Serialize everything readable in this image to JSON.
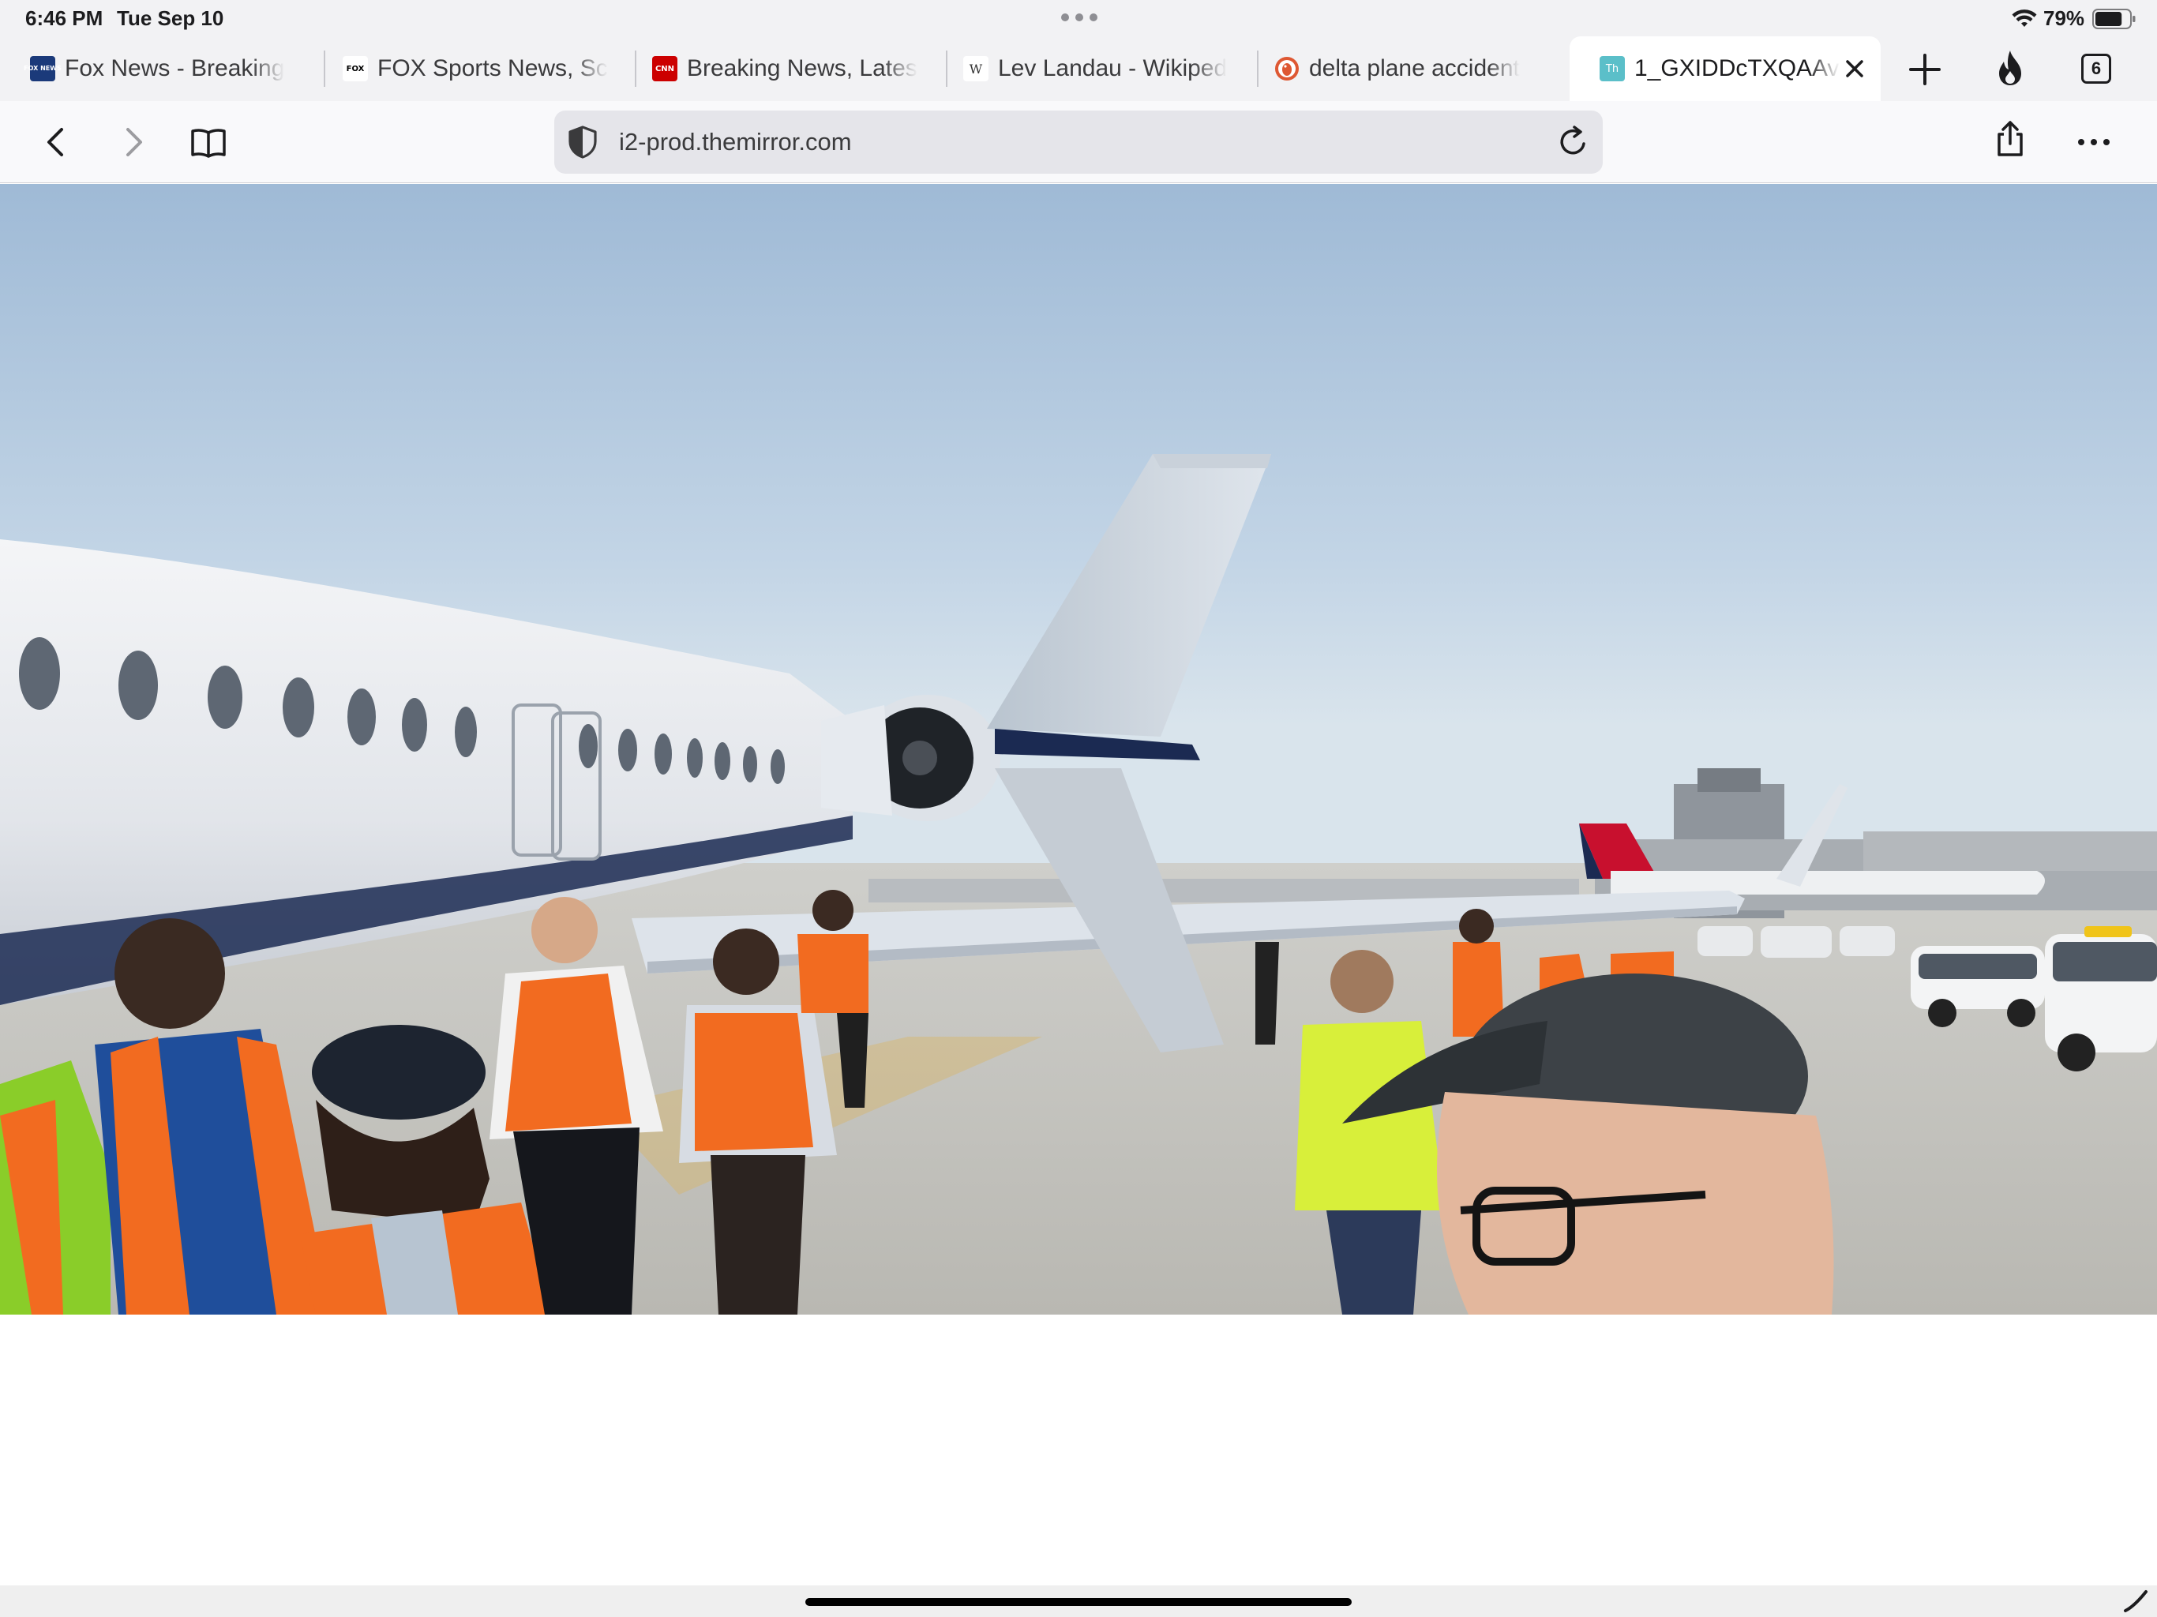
{
  "status_bar": {
    "time": "6:46 PM",
    "date": "Tue Sep 10",
    "battery_percent": "79%",
    "battery_level": 0.79,
    "icons": [
      "multitask-dots-icon",
      "wifi-icon",
      "battery-icon"
    ]
  },
  "tabs": [
    {
      "title": "Fox News - Breaking",
      "favicon": "fox-news-favicon",
      "active": false
    },
    {
      "title": "FOX Sports News, Sc",
      "favicon": "fox-sports-favicon",
      "active": false
    },
    {
      "title": "Breaking News, Lates",
      "favicon": "cnn-favicon",
      "active": false
    },
    {
      "title": "Lev Landau - Wikiped",
      "favicon": "wikipedia-favicon",
      "active": false
    },
    {
      "title": "delta plane accident",
      "favicon": "duckduckgo-favicon",
      "active": false
    },
    {
      "title": "1_GXIDDcTXQAAv",
      "favicon": "th-favicon",
      "active": true
    }
  ],
  "tab_favicons": {
    "fox_news": "FOX NEWS",
    "fox_sports": "FOX",
    "cnn": "CNN",
    "wikipedia": "W",
    "th": "Th"
  },
  "tab_bar_controls": {
    "icons": [
      "plus-icon",
      "flame-icon",
      "tab-overview-icon"
    ],
    "tab_count": "6"
  },
  "toolbar": {
    "icons": [
      "chevron-left-icon",
      "chevron-right-icon",
      "book-icon",
      "shield-icon",
      "reload-icon",
      "share-icon",
      "ellipsis-icon"
    ],
    "url": "i2-prod.themirror.com"
  },
  "content": {
    "image_subject": "photo",
    "icons": []
  },
  "colors": {
    "chrome_bg": "#f2f2f4",
    "url_field_bg": "#e5e5ea",
    "fox_news_blue": "#1b3a7a",
    "cnn_red": "#cc0000",
    "ddg_orange": "#de5833",
    "th_teal": "#5bbfc9",
    "delta_red": "#c8102e"
  }
}
